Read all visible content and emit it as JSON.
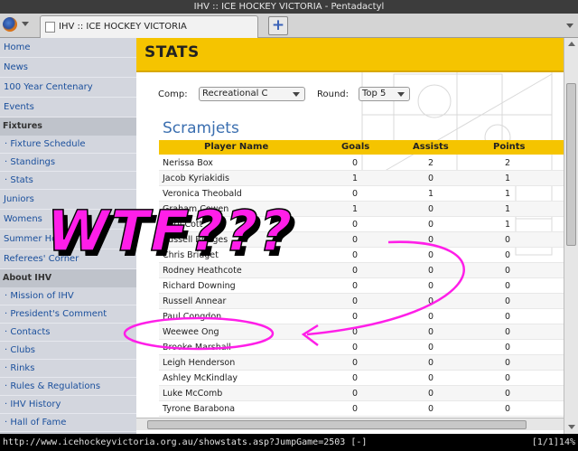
{
  "window": {
    "title": "IHV :: ICE HOCKEY VICTORIA - Pentadactyl"
  },
  "tab": {
    "title": "IHV :: ICE HOCKEY VICTORIA",
    "close": "×",
    "new": "+"
  },
  "sidebar": {
    "top": [
      {
        "label": "Home"
      },
      {
        "label": "News"
      },
      {
        "label": "100 Year Centenary"
      },
      {
        "label": "Events"
      }
    ],
    "fixtures_heading": "Fixtures",
    "fixtures": [
      {
        "label": "· Fixture Schedule"
      },
      {
        "label": "· Standings"
      },
      {
        "label": "· Stats"
      }
    ],
    "mid": [
      {
        "label": "Juniors"
      },
      {
        "label": "Womens"
      },
      {
        "label": "Summer Hockey"
      },
      {
        "label": "Referees' Corner"
      }
    ],
    "about_heading": "About IHV",
    "about": [
      {
        "label": "· Mission of IHV"
      },
      {
        "label": "· President's Comment"
      },
      {
        "label": "· Contacts"
      },
      {
        "label": "· Clubs"
      },
      {
        "label": "· Rinks"
      },
      {
        "label": "· Rules & Regulations"
      },
      {
        "label": "· IHV History"
      },
      {
        "label": "· Hall of Fame"
      }
    ]
  },
  "page": {
    "heading": "STATS",
    "comp_label": "Comp:",
    "comp_value": "Recreational C",
    "round_label": "Round:",
    "round_value": "Top 5",
    "team": "Scramjets",
    "columns": {
      "name": "Player Name",
      "goals": "Goals",
      "assists": "Assists",
      "points": "Points"
    },
    "rows": [
      {
        "name": "Nerissa Box",
        "goals": "0",
        "assists": "2",
        "points": "2"
      },
      {
        "name": "Jacob Kyriakidis",
        "goals": "1",
        "assists": "0",
        "points": "1"
      },
      {
        "name": "Veronica Theobald",
        "goals": "0",
        "assists": "1",
        "points": "1"
      },
      {
        "name": "Graham Cowen",
        "goals": "1",
        "assists": "0",
        "points": "1"
      },
      {
        "name": "Cyril Cott",
        "goals": "0",
        "assists": "0",
        "points": "1"
      },
      {
        "name": "Russell Bridges",
        "goals": "0",
        "assists": "0",
        "points": "0"
      },
      {
        "name": "Chris Bridget",
        "goals": "0",
        "assists": "0",
        "points": "0"
      },
      {
        "name": "Rodney Heathcote",
        "goals": "0",
        "assists": "0",
        "points": "0"
      },
      {
        "name": "Richard Downing",
        "goals": "0",
        "assists": "0",
        "points": "0"
      },
      {
        "name": "Russell Annear",
        "goals": "0",
        "assists": "0",
        "points": "0"
      },
      {
        "name": "Paul Congdon",
        "goals": "0",
        "assists": "0",
        "points": "0"
      },
      {
        "name": "Weewee Ong",
        "goals": "0",
        "assists": "0",
        "points": "0"
      },
      {
        "name": "Brooke Marshall",
        "goals": "0",
        "assists": "0",
        "points": "0"
      },
      {
        "name": "Leigh Henderson",
        "goals": "0",
        "assists": "0",
        "points": "0"
      },
      {
        "name": "Ashley McKindlay",
        "goals": "0",
        "assists": "0",
        "points": "0"
      },
      {
        "name": "Luke McComb",
        "goals": "0",
        "assists": "0",
        "points": "0"
      },
      {
        "name": "Tyrone Barabona",
        "goals": "0",
        "assists": "0",
        "points": "0"
      }
    ]
  },
  "overlay": {
    "text": "WTF???",
    "color": "#ff1ee8"
  },
  "statusbar": {
    "url": "http://www.icehockeyvictoria.org.au/showstats.asp?JumpGame=2503 [-]",
    "position": "[1/1]14%"
  },
  "colors": {
    "banner": "#f5c400",
    "link": "#1a4f9c",
    "team": "#3b6fb0"
  }
}
